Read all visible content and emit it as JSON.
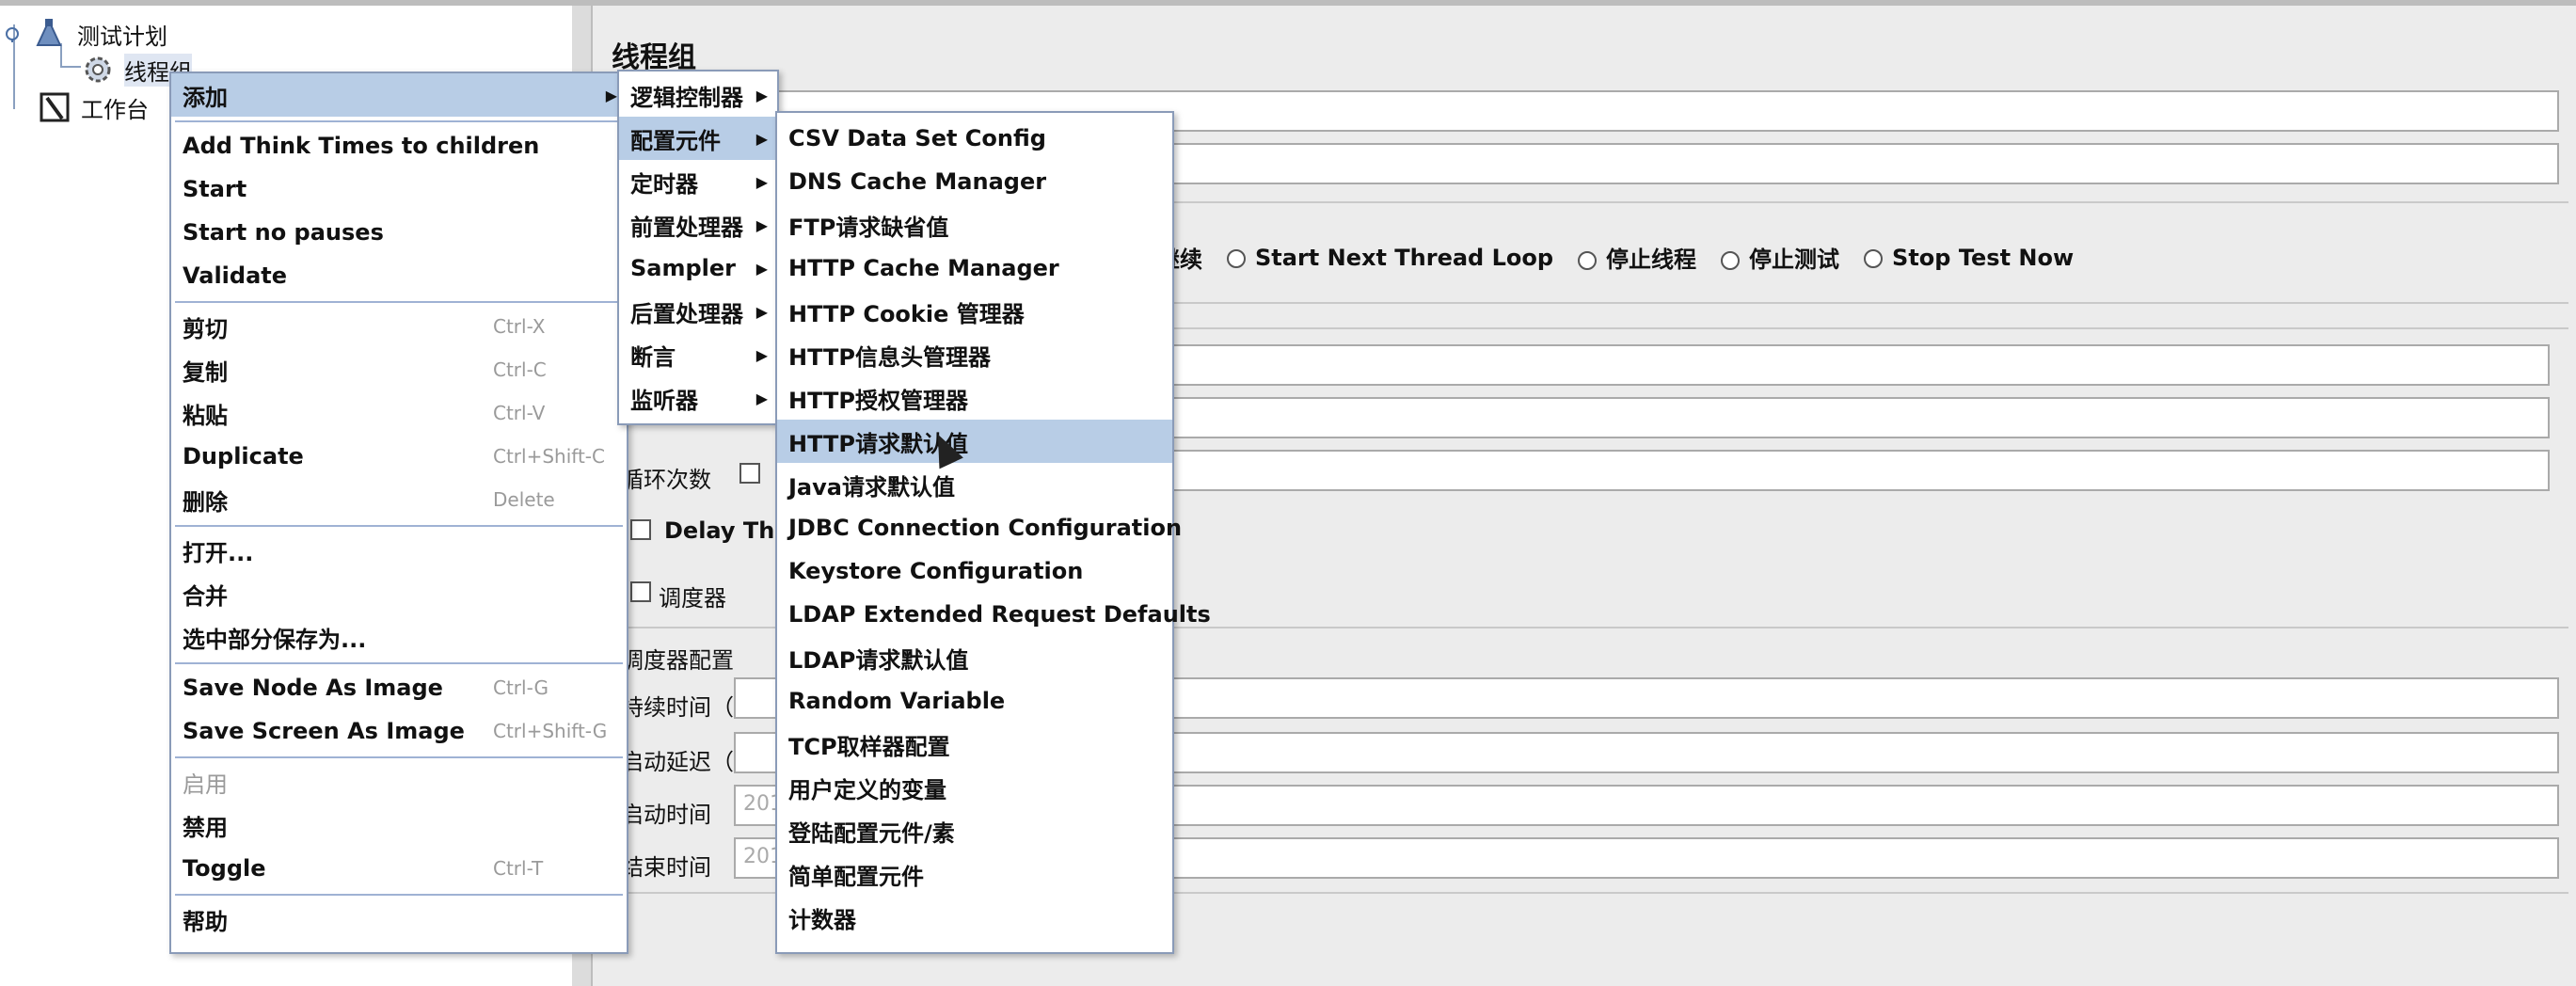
{
  "tree": {
    "nodes": [
      {
        "label": "测试计划",
        "icon": "test-plan-icon"
      },
      {
        "label": "线程组",
        "icon": "gear-icon"
      },
      {
        "label": "工作台",
        "icon": "workbench-icon"
      }
    ]
  },
  "panel": {
    "title": "线程组",
    "error_action_partial": "继续",
    "radio_options": [
      "Start Next Thread Loop",
      "停止线程",
      "停止测试",
      "Stop Test Now"
    ],
    "loop_label": "循环次数",
    "delay_label": "Delay Thre",
    "scheduler_label": "调度器",
    "scheduler_config": "调度器配置",
    "duration_label": "持续时间（秒",
    "startup_delay_label": "启动延迟（秒",
    "start_time_label": "启动时间",
    "start_time_value": "201",
    "end_time_label": "结束时间",
    "end_time_value": "201"
  },
  "context_menu": {
    "items": [
      {
        "label": "添加",
        "submenu": true,
        "selected": true
      },
      {
        "label": "Add Think Times to children"
      },
      {
        "label": "Start"
      },
      {
        "label": "Start no pauses"
      },
      {
        "label": "Validate"
      },
      {
        "label": "剪切",
        "shortcut": "Ctrl-X"
      },
      {
        "label": "复制",
        "shortcut": "Ctrl-C"
      },
      {
        "label": "粘贴",
        "shortcut": "Ctrl-V"
      },
      {
        "label": "Duplicate",
        "shortcut": "Ctrl+Shift-C"
      },
      {
        "label": "删除",
        "shortcut": "Delete"
      },
      {
        "label": "打开..."
      },
      {
        "label": "合并"
      },
      {
        "label": "选中部分保存为..."
      },
      {
        "label": "Save Node As Image",
        "shortcut": "Ctrl-G"
      },
      {
        "label": "Save Screen As Image",
        "shortcut": "Ctrl+Shift-G"
      },
      {
        "label": "启用",
        "disabled": true
      },
      {
        "label": "禁用"
      },
      {
        "label": "Toggle",
        "shortcut": "Ctrl-T"
      },
      {
        "label": "帮助"
      }
    ]
  },
  "add_submenu": {
    "items": [
      {
        "label": "逻辑控制器"
      },
      {
        "label": "配置元件",
        "selected": true
      },
      {
        "label": "定时器"
      },
      {
        "label": "前置处理器"
      },
      {
        "label": "Sampler"
      },
      {
        "label": "后置处理器"
      },
      {
        "label": "断言"
      },
      {
        "label": "监听器"
      }
    ]
  },
  "config_submenu": {
    "items": [
      "CSV Data Set Config",
      "DNS Cache Manager",
      "FTP请求缺省值",
      "HTTP Cache Manager",
      "HTTP Cookie 管理器",
      "HTTP信息头管理器",
      "HTTP授权管理器",
      "HTTP请求默认值",
      "Java请求默认值",
      "JDBC Connection Configuration",
      "Keystore Configuration",
      "LDAP Extended Request Defaults",
      "LDAP请求默认值",
      "Random Variable",
      "TCP取样器配置",
      "用户定义的变量",
      "登陆配置元件/素",
      "简单配置元件",
      "计数器"
    ],
    "selected_index": 7
  },
  "colors": {
    "menu_highlight": "#b8cde6",
    "menu_border": "#8a9bb8"
  }
}
